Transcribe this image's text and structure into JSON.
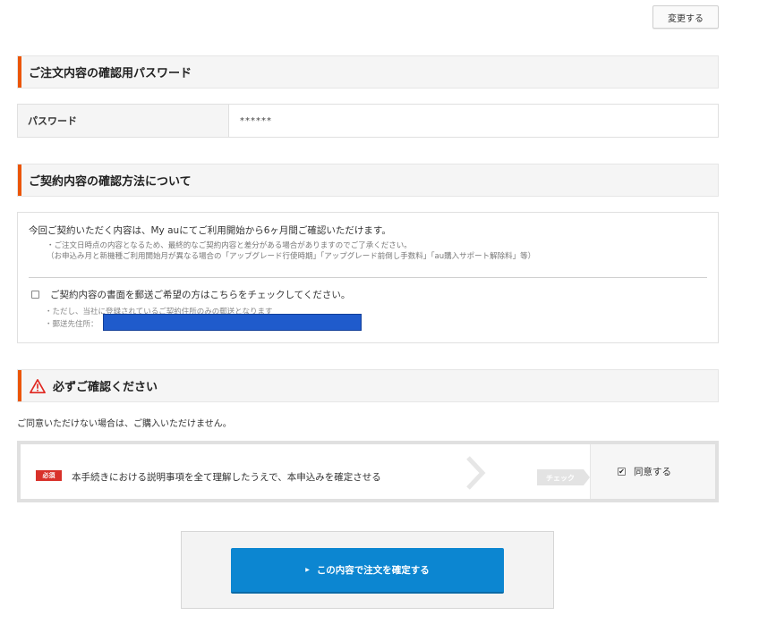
{
  "top": {
    "change_label": "変更する"
  },
  "password_section": {
    "title": "ご注文内容の確認用パスワード",
    "label": "パスワード",
    "value": "******"
  },
  "method_section": {
    "title": "ご契約内容の確認方法について",
    "lead": "今回ご契約いただく内容は、My auにてご利用開始から6ヶ月間ご確認いただけます。",
    "note1": "・ご注文日時点の内容となるため、最終的なご契約内容と差分がある場合がありますのでご了承ください。",
    "note2": "（お申込み月と新機種ご利用開始月が異なる場合の「アップグレード行使時期」「アップグレード前倒し手数料」「au購入サポート解除料」等）",
    "checkbox_label": "ご契約内容の書面を郵送ご希望の方はこちらをチェックしてください。",
    "sub1": "・ただし、当社に登録されているご契約住所のみの郵送となります",
    "sub2": "・郵送先住所："
  },
  "confirm_section": {
    "title": "必ずご確認ください",
    "no_agree_text": "ご同意いただけない場合は、ご購入いただけません。",
    "required_badge": "必須",
    "agree_text": "本手続きにおける説明事項を全て理解したうえで、本申込みを確定させる",
    "check_tag": "チェック",
    "agree_label": "同意する",
    "agree_checked": "✔"
  },
  "submit": {
    "label": "この内容で注文を確定する",
    "arrow": "▶"
  },
  "colors": {
    "accent": "#eb5505",
    "primary_button": "#0c86d1",
    "required_badge": "#d8312a"
  },
  "icons": {
    "warning": "warning-triangle-icon",
    "chevron": "chevron-right-icon"
  }
}
